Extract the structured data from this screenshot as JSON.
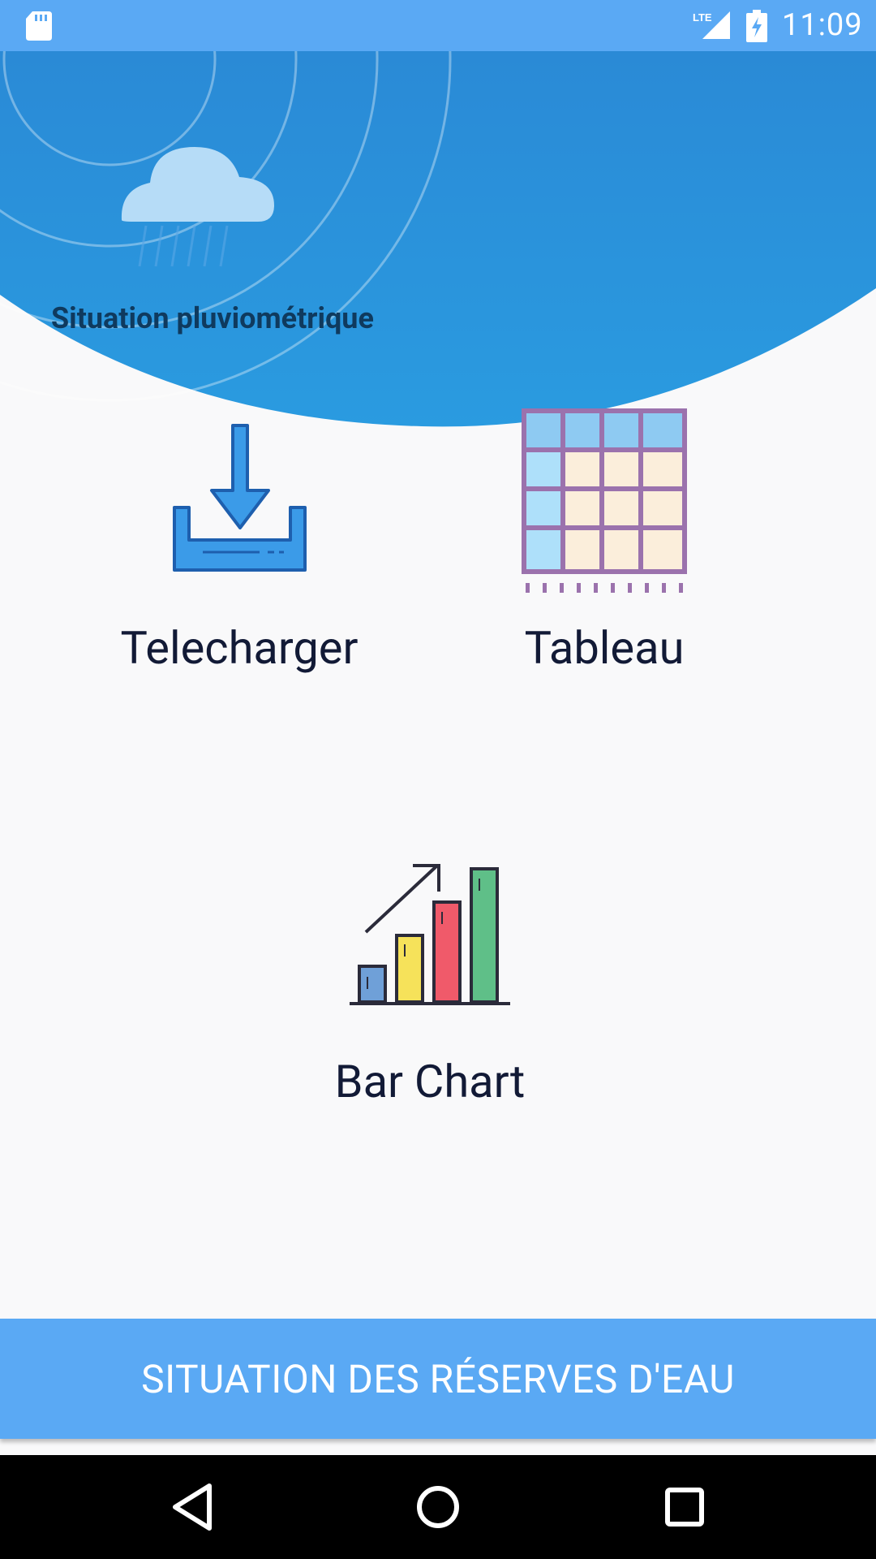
{
  "status_bar": {
    "time": "11:09",
    "network": "LTE",
    "icons": [
      "sd-card-icon",
      "lte-signal-icon",
      "battery-charging-icon"
    ]
  },
  "header": {
    "title": "Situation pluviométrique"
  },
  "tiles": [
    {
      "label": "Telecharger",
      "icon": "download-icon"
    },
    {
      "label": "Tableau",
      "icon": "table-grid-icon"
    },
    {
      "label": "Bar Chart",
      "icon": "bar-chart-icon"
    }
  ],
  "bottom_button": {
    "label": "SITUATION DES RÉSERVES D'EAU"
  },
  "nav": {
    "buttons": [
      "back-icon",
      "home-icon",
      "recent-apps-icon"
    ]
  },
  "colors": {
    "accent": "#5aa9f4",
    "hero_blue": "#2a8fd9",
    "title_text": "#0f3a5e",
    "label_text": "#121a36",
    "background": "#f9f9fa"
  }
}
